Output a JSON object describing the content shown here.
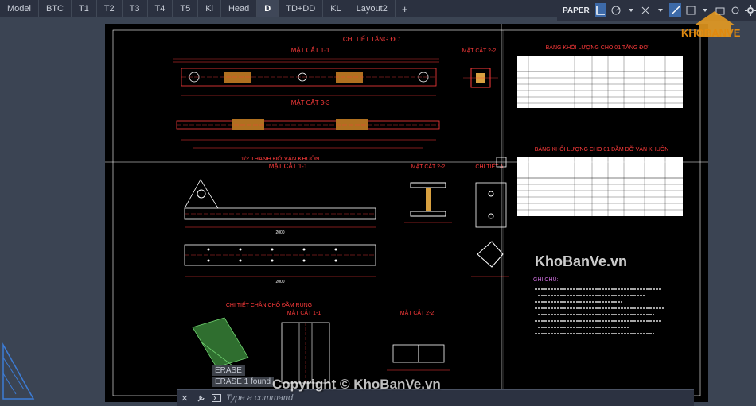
{
  "layout_tabs": [
    "Model",
    "BTC",
    "T1",
    "T2",
    "T3",
    "T4",
    "T5",
    "Ki",
    "Head",
    "D",
    "TD+DD",
    "KL",
    "Layout2"
  ],
  "active_tab": "D",
  "add_tab": "+",
  "status": {
    "paper": "PAPER"
  },
  "drawing": {
    "main_title": "CHI TIẾT TĂNG ĐƠ",
    "sec_1_1_a": "MẶT CẮT 1-1",
    "sec_2_2_a": "MẶT CẮT 2-2",
    "sec_3_3": "MẶT CẮT 3-3",
    "half_bar": "1/2 THANH ĐỠ VÁN KHUÔN",
    "sec_1_1_b": "MẶT CẮT 1-1",
    "sec_2_2_b": "MẶT CẮT 2-2",
    "detail_a": "CHI TIẾT A",
    "support_title": "CHI TIẾT CHÂN CHỐ ĐẦM RUNG",
    "sec_1_1_c": "MẶT CẮT 1-1",
    "sec_2_2_c": "MẶT CẮT 2-2",
    "table1_title": "BẢNG KHỐI LƯỢNG CHO 01 TĂNG ĐƠ",
    "table2_title": "BẢNG KHỐI LƯỢNG CHO 01 DẦM ĐỠ VÁN KHUÔN",
    "notes_title": "GHI CHÚ:",
    "dims": [
      "1000",
      "2000",
      "2000",
      "900",
      "300",
      "200"
    ]
  },
  "command": {
    "history": [
      "ERASE 1 found",
      "ERASE"
    ],
    "placeholder": "Type a command"
  },
  "watermarks": {
    "center": "Copyright © KhoBanVe.vn",
    "right": "KhoBanVe.vn",
    "logo": "KHOBANVE"
  }
}
